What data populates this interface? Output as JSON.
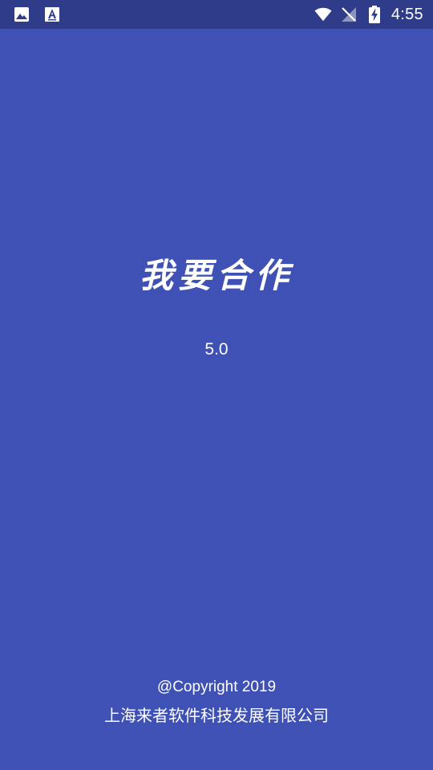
{
  "status_bar": {
    "time": "4:55",
    "left_icons": [
      "image-notification-icon",
      "text-notification-icon"
    ],
    "right_icons": [
      "wifi-icon",
      "no-signal-icon",
      "battery-charging-icon"
    ]
  },
  "splash": {
    "app_name": "我要合作",
    "version": "5.0"
  },
  "footer": {
    "copyright": "@Copyright 2019",
    "company": "上海来者软件科技发展有限公司"
  },
  "colors": {
    "background": "#3F51B5",
    "status_bar": "#2F3C8A",
    "text": "#FFFFFF"
  }
}
